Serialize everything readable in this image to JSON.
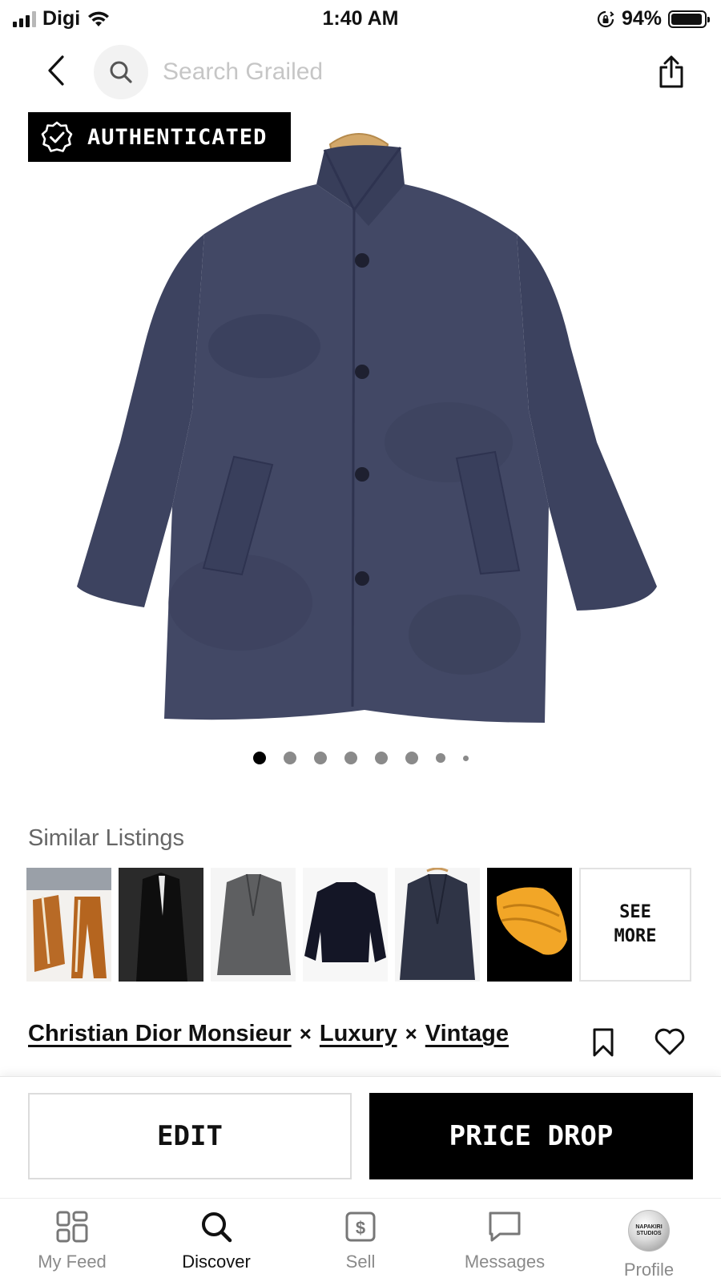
{
  "status_bar": {
    "carrier": "Digi",
    "time": "1:40 AM",
    "battery": "94%",
    "battery_level": 0.94,
    "icons": [
      "signal-icon",
      "wifi-icon",
      "orientation-lock-icon",
      "battery-icon"
    ]
  },
  "top_nav": {
    "search_placeholder": "Search Grailed",
    "icons": [
      "back-icon",
      "search-icon",
      "share-icon"
    ]
  },
  "hero": {
    "badge": "AUTHENTICATED",
    "image_count": 8,
    "current_image": 1
  },
  "similar": {
    "title": "Similar Listings",
    "see_more_line1": "SEE",
    "see_more_line2": "MORE",
    "thumbnail_count": 6
  },
  "listing": {
    "designers": [
      "Christian Dior Monsieur",
      "Luxury",
      "Vintage"
    ],
    "separator": "×"
  },
  "actions": {
    "edit": "EDIT",
    "price_drop": "PRICE DROP"
  },
  "tab_bar": {
    "tabs": [
      {
        "label": "My Feed",
        "icon": "grid-icon"
      },
      {
        "label": "Discover",
        "icon": "search-icon",
        "active": true
      },
      {
        "label": "Sell",
        "icon": "dollar-tag-icon"
      },
      {
        "label": "Messages",
        "icon": "chat-icon"
      },
      {
        "label": "Profile",
        "icon": "avatar"
      }
    ],
    "avatar_text": "NAPAKIRI STUDIOS"
  },
  "colors": {
    "black": "#000000",
    "placeholder": "#c6c6c6",
    "muted": "#8a8a8a",
    "coat": "#3f4562"
  }
}
